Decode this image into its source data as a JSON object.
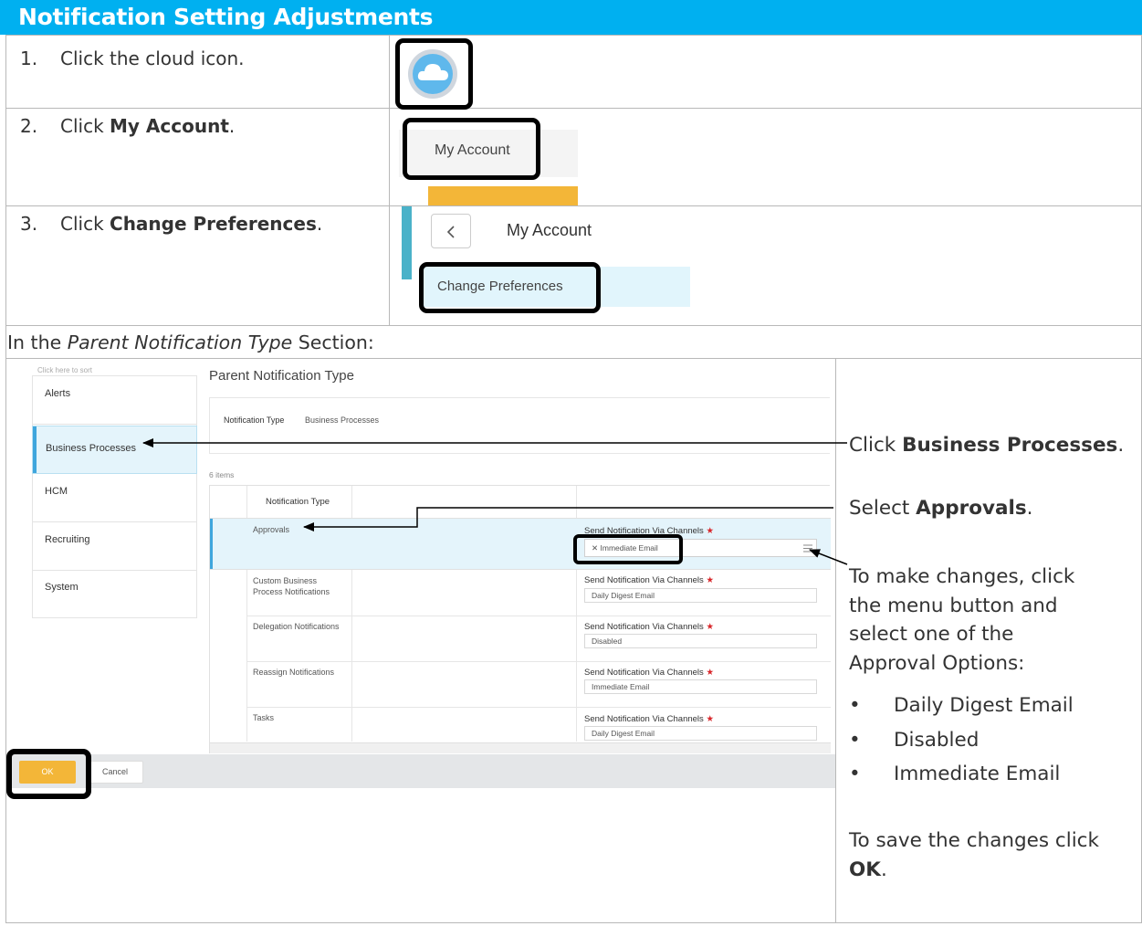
{
  "header": {
    "title": "Notification Setting Adjustments"
  },
  "steps": [
    {
      "num": "1.",
      "pre": "Click the cloud icon.",
      "bold": "",
      "post": ""
    },
    {
      "num": "2.",
      "pre": "Click ",
      "bold": "My Account",
      "post": "."
    },
    {
      "num": "3.",
      "pre": "Click ",
      "bold": "Change Preferences",
      "post": "."
    }
  ],
  "shot2": {
    "account_label": "My Account"
  },
  "shot3": {
    "title": "My Account",
    "change_prefs": "Change Preferences"
  },
  "section_intro": {
    "pre": "In the ",
    "italic": "Parent Notification Type",
    "post": " Section:"
  },
  "wd": {
    "sort_hint": "Click here to sort",
    "nav": [
      "Alerts",
      "Business Processes",
      "HCM",
      "Recruiting",
      "System"
    ],
    "panel_title": "Parent Notification Type",
    "nt_label": "Notification Type",
    "nt_value": "Business Processes",
    "items_count": "6 items",
    "col_header": "Notification Type",
    "channel_label": "Send Notification Via Channels",
    "star": "★",
    "rows": [
      {
        "name": "Approvals",
        "channel": "Immediate Email"
      },
      {
        "name": "Custom Business Process Notifications",
        "channel": "Daily Digest Email"
      },
      {
        "name": "Delegation Notifications",
        "channel": "Disabled"
      },
      {
        "name": "Reassign Notifications",
        "channel": "Immediate Email"
      },
      {
        "name": "Tasks",
        "channel": "Daily Digest Email"
      }
    ],
    "ok_label": "OK",
    "cancel_label": "Cancel"
  },
  "callouts": {
    "c1_pre": "Click ",
    "c1_bold": "Business Processes",
    "c1_post": ".",
    "c2_pre": "Select ",
    "c2_bold": "Approvals",
    "c2_post": ".",
    "c3_lines": [
      "To make changes, click",
      "the menu button and",
      "select one of the",
      "Approval Options:"
    ],
    "options": [
      "Daily Digest Email",
      "Disabled",
      "Immediate Email"
    ],
    "save_line": "To save the changes click",
    "save_bold": "OK",
    "save_post": "."
  },
  "colors": {
    "header": "#00b0f0",
    "accent_orange": "#f3b638",
    "selected_bg": "#e4f4fb",
    "selected_bar": "#3fa6dd"
  }
}
